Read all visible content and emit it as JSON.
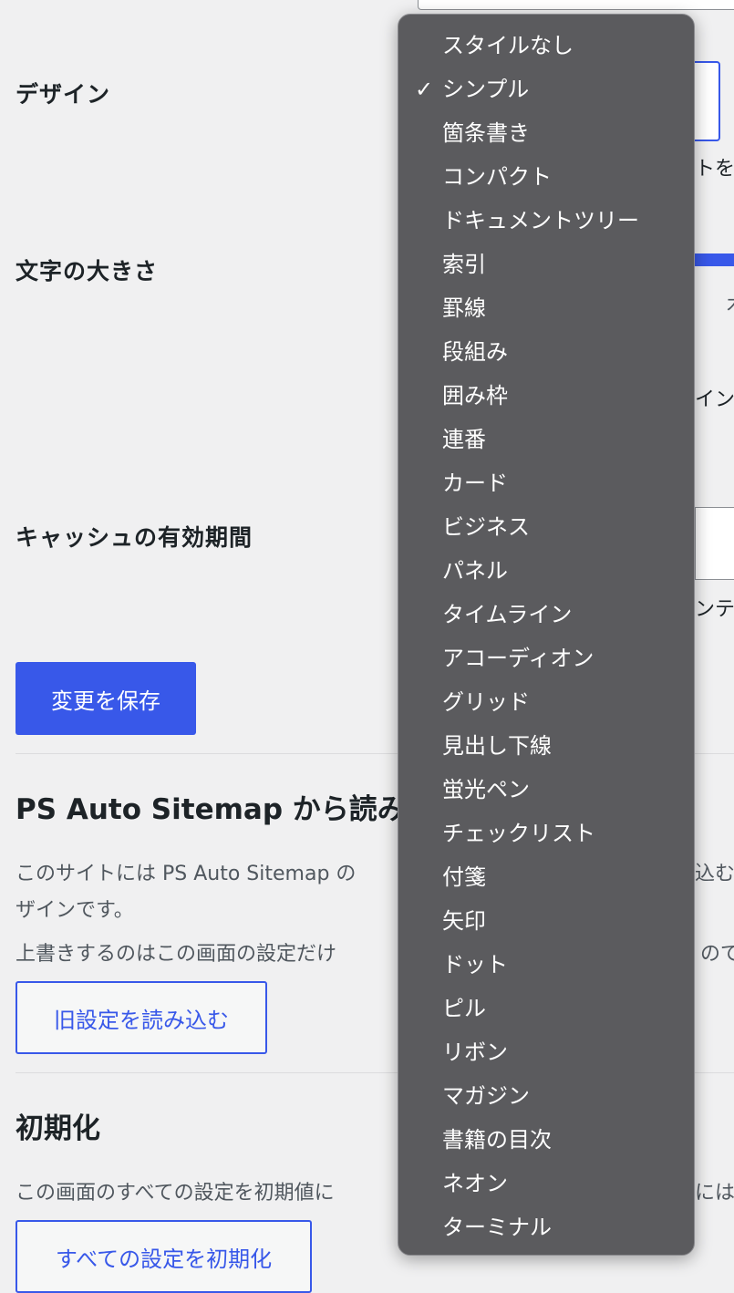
{
  "settings": {
    "design_label": "デザイン",
    "font_size_label": "文字の大きさ",
    "cache_label": "キャッシュの有効期間",
    "save_button": "変更を保存",
    "fragments": {
      "design_hint": "トを",
      "font_hint": "木",
      "font_hint2": "イン",
      "cache_hint": "ンテ"
    }
  },
  "import_section": {
    "title": "PS Auto Sitemap から読み込",
    "desc_line1": "このサイトには PS Auto Sitemap の",
    "desc_line1_tail": "込む",
    "desc_line2": "ザインです。",
    "desc_line3": "上書きするのはこの画面の設定だけ",
    "desc_line3_tail": "ので",
    "button": "旧設定を読み込む"
  },
  "reset_section": {
    "title": "初期化",
    "desc": "この画面のすべての設定を初期値に",
    "desc_tail": "には",
    "button": "すべての設定を初期化"
  },
  "dropdown": {
    "check_glyph": "✓",
    "selected_index": 1,
    "options": [
      "スタイルなし",
      "シンプル",
      "箇条書き",
      "コンパクト",
      "ドキュメントツリー",
      "索引",
      "罫線",
      "段組み",
      "囲み枠",
      "連番",
      "カード",
      "ビジネス",
      "パネル",
      "タイムライン",
      "アコーディオン",
      "グリッド",
      "見出し下線",
      "蛍光ペン",
      "チェックリスト",
      "付箋",
      "矢印",
      "ドット",
      "ピル",
      "リボン",
      "マガジン",
      "書籍の目次",
      "ネオン",
      "ターミナル"
    ]
  },
  "colors": {
    "accent": "#3858e9",
    "menu_bg": "#5b5b5e",
    "page_bg": "#f0f0f1"
  }
}
